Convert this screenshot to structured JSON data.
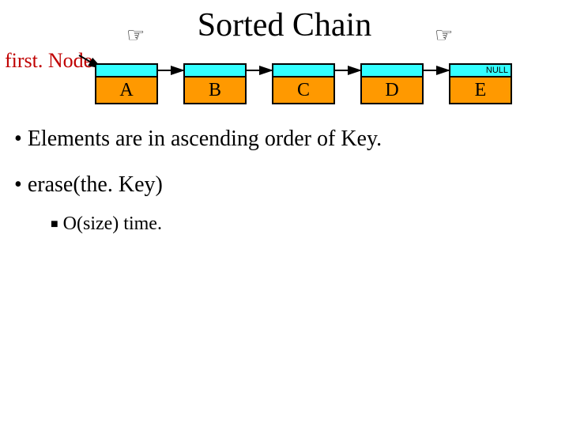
{
  "title": "Sorted Chain",
  "firstNodeLabel": "first. Node",
  "nullLabel": "NULL",
  "nodes": [
    "A",
    "B",
    "C",
    "D",
    "E"
  ],
  "bullets": {
    "line1": "Elements are in ascending order of Key.",
    "line2": "erase(the. Key)",
    "sub1": "O(size) time."
  },
  "icons": {
    "handLeft": "hand-pointing-icon",
    "handRight": "hand-pointing-icon"
  }
}
